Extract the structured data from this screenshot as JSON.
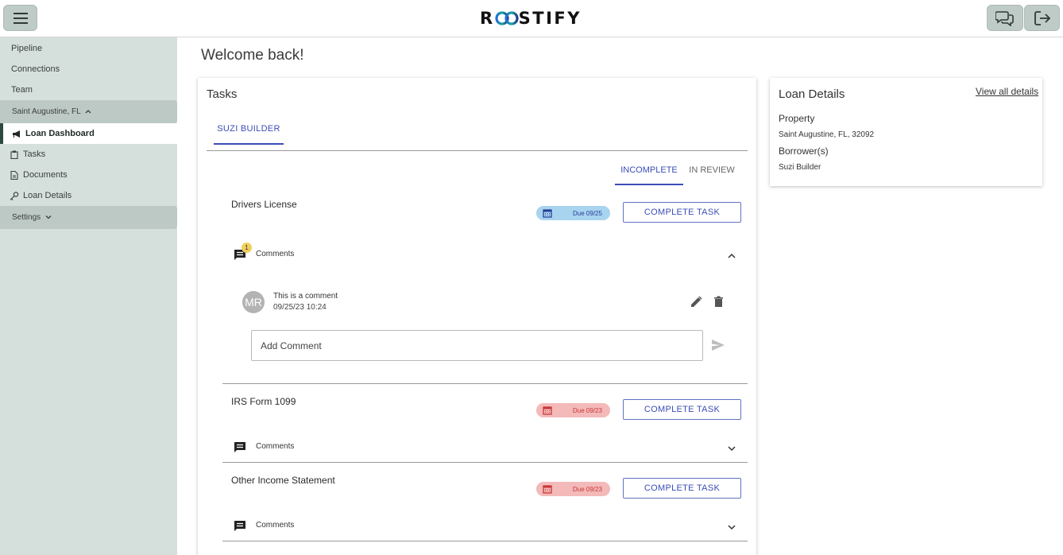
{
  "header": {
    "logo_text_left": "R",
    "logo_text_right": "STIFY",
    "menu_icon": "hamburger-icon",
    "chat_icon": "chat-bubbles-icon",
    "logout_icon": "logout-icon"
  },
  "sidebar": {
    "top_items": [
      {
        "label": "Pipeline"
      },
      {
        "label": "Connections"
      },
      {
        "label": "Team"
      }
    ],
    "group": {
      "label": "Saint Augustine, FL",
      "chevron": "chevron-up-icon"
    },
    "sub_items": [
      {
        "label": "Loan Dashboard",
        "icon": "megaphone-icon",
        "active": true
      },
      {
        "label": "Tasks",
        "icon": "clipboard-icon"
      },
      {
        "label": "Documents",
        "icon": "document-icon"
      },
      {
        "label": "Loan Details",
        "icon": "key-icon"
      }
    ],
    "settings": {
      "label": "Settings",
      "chevron": "chevron-down-icon"
    }
  },
  "main": {
    "welcome": "Welcome back!",
    "tasks": {
      "title": "Tasks",
      "user_tab": "SUZI BUILDER",
      "status_tabs": [
        "INCOMPLETE",
        "IN REVIEW"
      ],
      "complete_label": "COMPLETE TASK",
      "comments_label": "Comments",
      "items": [
        {
          "name": "Drivers License",
          "due": "Due 09/25",
          "status_color": "#a8d4ef",
          "comment_count": "1",
          "expanded": true
        },
        {
          "name": "IRS Form 1099",
          "due": "Due 09/23",
          "status_color": "#f4b9b9",
          "expanded": false
        },
        {
          "name": "Other Income Statement",
          "due": "Due 09/23",
          "status_color": "#f4b9b9",
          "expanded": false
        }
      ],
      "comment": {
        "initials": "MR",
        "text": "This is a comment",
        "timestamp": "09/25/23 10:24"
      },
      "add_comment_placeholder": "Add Comment"
    },
    "loan_details": {
      "title": "Loan Details",
      "view_all": "View all details",
      "property_label": "Property",
      "property_value": "Saint Augustine, FL, 32092",
      "borrowers_label": "Borrower(s)",
      "borrowers_value": "Suzi Builder"
    }
  },
  "colors": {
    "accent": "#3b4db7",
    "sidebar_bg": "#d5e0dc",
    "sidebar_group": "#bdc9c4",
    "due_blue": "#a8d4ef",
    "due_red": "#f4b9b9"
  }
}
